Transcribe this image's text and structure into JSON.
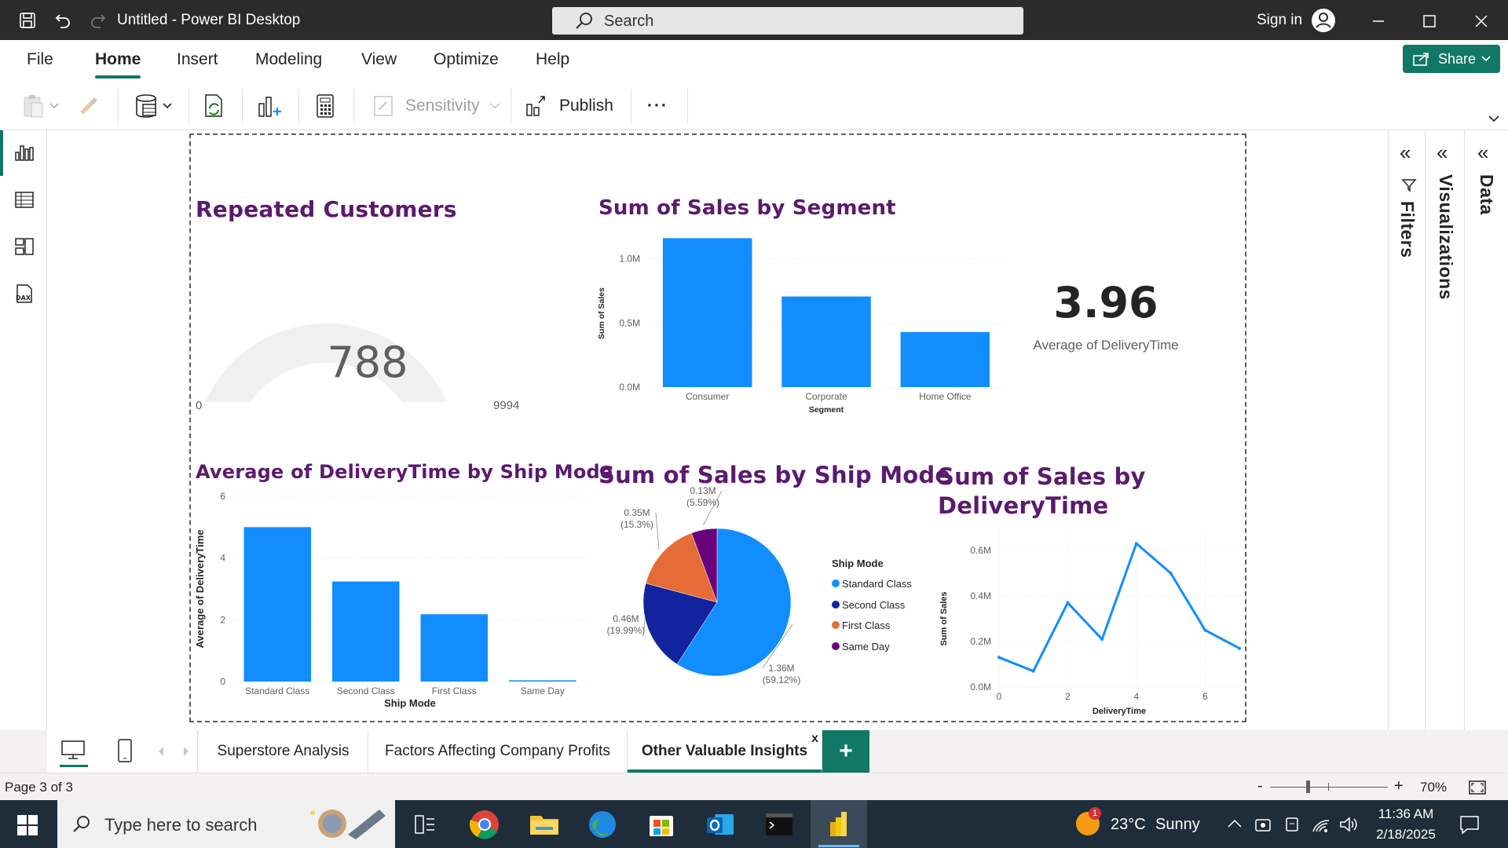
{
  "titlebar": {
    "title": "Untitled - Power BI Desktop",
    "search_placeholder": "Search",
    "sign_in": "Sign in"
  },
  "menu": {
    "items": [
      "File",
      "Home",
      "Insert",
      "Modeling",
      "View",
      "Optimize",
      "Help"
    ],
    "active": "Home",
    "share_label": "Share"
  },
  "ribbon": {
    "sensitivity_label": "Sensitivity",
    "publish_label": "Publish",
    "more_label": "···"
  },
  "panes": {
    "filters": "Filters",
    "visualizations": "Visualizations",
    "data": "Data"
  },
  "visuals": {
    "gauge": {
      "title": "Repeated Customers",
      "value": "788",
      "min": "0",
      "max": "9994",
      "value_num": 788,
      "max_num": 9994
    },
    "card": {
      "value": "3.96",
      "label": "Average of DeliveryTime"
    }
  },
  "chart_data": [
    {
      "type": "bar",
      "title": "Sum of Sales by Segment",
      "xlabel": "Segment",
      "ylabel": "Sum of Sales",
      "categories": [
        "Consumer",
        "Corporate",
        "Home Office"
      ],
      "values": [
        1160000,
        706000,
        429000
      ],
      "yticks": [
        "0.0M",
        "0.5M",
        "1.0M"
      ],
      "ytick_values": [
        0,
        500000,
        1000000
      ],
      "ylim": [
        0,
        1150000
      ],
      "color": "#118dff"
    },
    {
      "type": "bar",
      "title": "Average of DeliveryTime by Ship Mode",
      "xlabel": "Ship Mode",
      "ylabel": "Average of DeliveryTime",
      "categories": [
        "Standard Class",
        "Second Class",
        "First Class",
        "Same Day"
      ],
      "values": [
        5.0,
        3.24,
        2.18,
        0.04
      ],
      "yticks": [
        "0",
        "2",
        "4",
        "6"
      ],
      "ytick_values": [
        0,
        2,
        4,
        6
      ],
      "ylim": [
        0,
        6
      ],
      "color": "#118dff"
    },
    {
      "type": "pie",
      "title": "Sum of Sales by Ship Mode",
      "legend_title": "Ship Mode",
      "legend": [
        "Standard Class",
        "Second Class",
        "First Class",
        "Same Day"
      ],
      "values": [
        1.36,
        0.46,
        0.35,
        0.13
      ],
      "percents": [
        59.12,
        19.99,
        15.3,
        5.59
      ],
      "labels": [
        "1.36M",
        "0.46M",
        "0.35M",
        "0.13M"
      ],
      "pct_labels": [
        "(59.12%)",
        "(19.99%)",
        "(15.3%)",
        "(5.59%)"
      ],
      "colors": [
        "#118dff",
        "#12239e",
        "#e66c37",
        "#6b007b"
      ]
    },
    {
      "type": "line",
      "title": "Sum of Sales by DeliveryTime",
      "title_lines": [
        "Sum of Sales by",
        "DeliveryTime"
      ],
      "xlabel": "DeliveryTime",
      "ylabel": "Sum of Sales",
      "x": [
        0,
        1,
        2,
        3,
        4,
        5,
        6,
        7
      ],
      "y": [
        0.13,
        0.07,
        0.37,
        0.21,
        0.63,
        0.5,
        0.25,
        0.17
      ],
      "xticks": [
        "0",
        "2",
        "4",
        "6"
      ],
      "xtick_values": [
        0,
        2,
        4,
        6
      ],
      "yticks": [
        "0.0M",
        "0.2M",
        "0.4M",
        "0.6M"
      ],
      "ytick_values": [
        0,
        0.2,
        0.4,
        0.6
      ],
      "xlim": [
        0,
        7
      ],
      "ylim": [
        0,
        0.6
      ],
      "color": "#118dff"
    }
  ],
  "pages": {
    "tabs": [
      "Superstore Analysis",
      "Factors Affecting Company Profits",
      "Other Valuable Insights"
    ],
    "active": "Other Valuable Insights",
    "close_label": "x",
    "add_label": "+"
  },
  "status": {
    "page": "Page 3 of 3",
    "zoom": "70%",
    "zoom_minus": "-",
    "zoom_plus": "+"
  },
  "taskbar": {
    "search_placeholder": "Type here to search",
    "weather_temp": "23°C",
    "weather_cond": "Sunny",
    "weather_badge": "1",
    "time": "11:36 AM",
    "date": "2/18/2025"
  }
}
